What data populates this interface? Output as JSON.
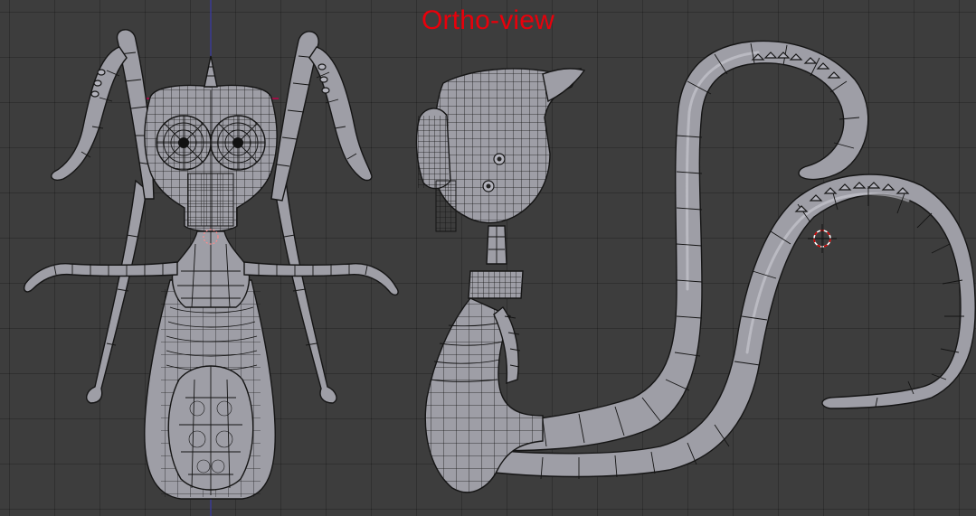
{
  "viewport": {
    "title": "Ortho-view",
    "background_color": "#3d3d3d",
    "title_color": "#e8000b",
    "views": [
      "front-view",
      "side-view"
    ]
  },
  "icons": {
    "cursor": "3d-cursor-icon"
  }
}
